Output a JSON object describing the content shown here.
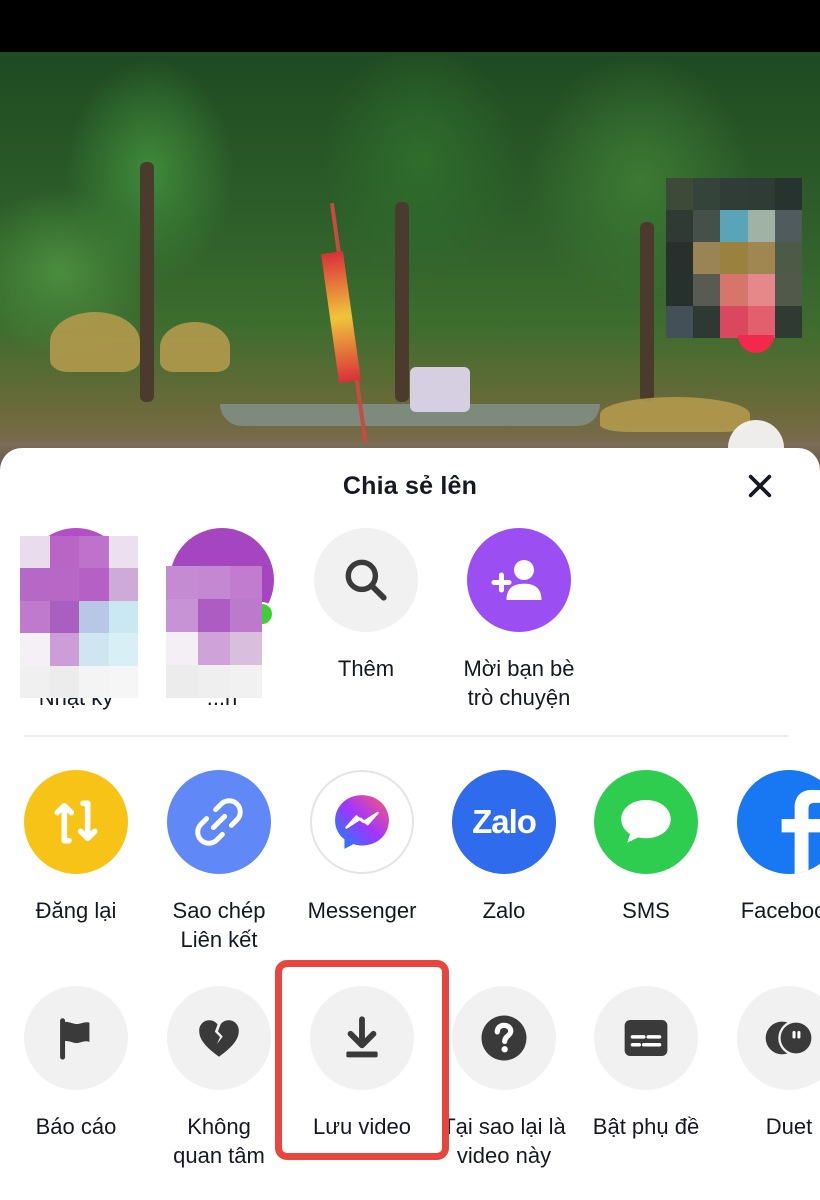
{
  "sheet": {
    "title": "Chia sẻ lên",
    "close_icon": "close-icon"
  },
  "contacts": [
    {
      "label": "Thêm vào\nNhật ký",
      "icon": "avatar-blurred",
      "color": "#b34fc4"
    },
    {
      "label": "N...huy\n...n",
      "icon": "avatar-blurred",
      "color": "#a545c0",
      "online": true
    },
    {
      "label": "Thêm",
      "icon": "search-icon",
      "color": "#f1f1f2"
    },
    {
      "label": "Mời bạn bè\ntrò chuyện",
      "icon": "add-friend-icon",
      "color": "#9b4ff2"
    }
  ],
  "share_targets": [
    {
      "label": "Đăng lại",
      "icon": "repost-icon",
      "color": "#f7c317"
    },
    {
      "label": "Sao chép\nLiên kết",
      "icon": "link-icon",
      "color": "#6088f6"
    },
    {
      "label": "Messenger",
      "icon": "messenger-icon",
      "color": "#ffffff"
    },
    {
      "label": "Zalo",
      "icon": "zalo-icon",
      "color": "#2f6bed"
    },
    {
      "label": "SMS",
      "icon": "sms-icon",
      "color": "#2fcd4f"
    },
    {
      "label": "Facebook",
      "icon": "facebook-icon",
      "color": "#1877f2"
    }
  ],
  "actions": [
    {
      "label": "Báo cáo",
      "icon": "flag-icon"
    },
    {
      "label": "Không\nquan tâm",
      "icon": "broken-heart-icon"
    },
    {
      "label": "Lưu video",
      "icon": "download-icon",
      "highlighted": true
    },
    {
      "label": "Tại sao lại là\nvideo này",
      "icon": "question-icon"
    },
    {
      "label": "Bật phụ đề",
      "icon": "captions-icon"
    },
    {
      "label": "Duet",
      "icon": "duet-icon"
    }
  ],
  "colors": {
    "highlight": "#e8453f",
    "icon_dark": "#3a3a3a",
    "action_bg": "#f1f1f2"
  }
}
